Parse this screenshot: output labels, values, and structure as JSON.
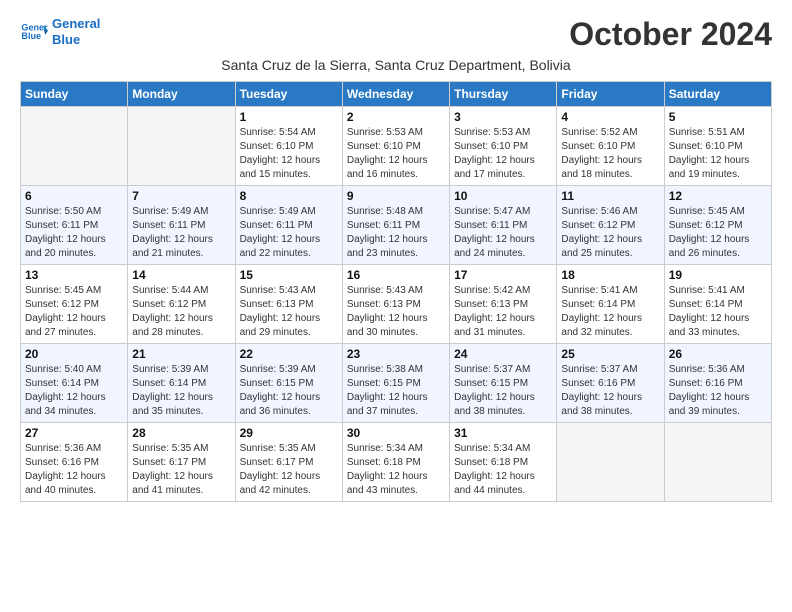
{
  "header": {
    "logo_line1": "General",
    "logo_line2": "Blue",
    "month_title": "October 2024",
    "subtitle": "Santa Cruz de la Sierra, Santa Cruz Department, Bolivia"
  },
  "weekdays": [
    "Sunday",
    "Monday",
    "Tuesday",
    "Wednesday",
    "Thursday",
    "Friday",
    "Saturday"
  ],
  "weeks": [
    [
      {
        "day": "",
        "info": ""
      },
      {
        "day": "",
        "info": ""
      },
      {
        "day": "1",
        "sunrise": "5:54 AM",
        "sunset": "6:10 PM",
        "daylight": "12 hours and 15 minutes."
      },
      {
        "day": "2",
        "sunrise": "5:53 AM",
        "sunset": "6:10 PM",
        "daylight": "12 hours and 16 minutes."
      },
      {
        "day": "3",
        "sunrise": "5:53 AM",
        "sunset": "6:10 PM",
        "daylight": "12 hours and 17 minutes."
      },
      {
        "day": "4",
        "sunrise": "5:52 AM",
        "sunset": "6:10 PM",
        "daylight": "12 hours and 18 minutes."
      },
      {
        "day": "5",
        "sunrise": "5:51 AM",
        "sunset": "6:10 PM",
        "daylight": "12 hours and 19 minutes."
      }
    ],
    [
      {
        "day": "6",
        "sunrise": "5:50 AM",
        "sunset": "6:11 PM",
        "daylight": "12 hours and 20 minutes."
      },
      {
        "day": "7",
        "sunrise": "5:49 AM",
        "sunset": "6:11 PM",
        "daylight": "12 hours and 21 minutes."
      },
      {
        "day": "8",
        "sunrise": "5:49 AM",
        "sunset": "6:11 PM",
        "daylight": "12 hours and 22 minutes."
      },
      {
        "day": "9",
        "sunrise": "5:48 AM",
        "sunset": "6:11 PM",
        "daylight": "12 hours and 23 minutes."
      },
      {
        "day": "10",
        "sunrise": "5:47 AM",
        "sunset": "6:11 PM",
        "daylight": "12 hours and 24 minutes."
      },
      {
        "day": "11",
        "sunrise": "5:46 AM",
        "sunset": "6:12 PM",
        "daylight": "12 hours and 25 minutes."
      },
      {
        "day": "12",
        "sunrise": "5:45 AM",
        "sunset": "6:12 PM",
        "daylight": "12 hours and 26 minutes."
      }
    ],
    [
      {
        "day": "13",
        "sunrise": "5:45 AM",
        "sunset": "6:12 PM",
        "daylight": "12 hours and 27 minutes."
      },
      {
        "day": "14",
        "sunrise": "5:44 AM",
        "sunset": "6:12 PM",
        "daylight": "12 hours and 28 minutes."
      },
      {
        "day": "15",
        "sunrise": "5:43 AM",
        "sunset": "6:13 PM",
        "daylight": "12 hours and 29 minutes."
      },
      {
        "day": "16",
        "sunrise": "5:43 AM",
        "sunset": "6:13 PM",
        "daylight": "12 hours and 30 minutes."
      },
      {
        "day": "17",
        "sunrise": "5:42 AM",
        "sunset": "6:13 PM",
        "daylight": "12 hours and 31 minutes."
      },
      {
        "day": "18",
        "sunrise": "5:41 AM",
        "sunset": "6:14 PM",
        "daylight": "12 hours and 32 minutes."
      },
      {
        "day": "19",
        "sunrise": "5:41 AM",
        "sunset": "6:14 PM",
        "daylight": "12 hours and 33 minutes."
      }
    ],
    [
      {
        "day": "20",
        "sunrise": "5:40 AM",
        "sunset": "6:14 PM",
        "daylight": "12 hours and 34 minutes."
      },
      {
        "day": "21",
        "sunrise": "5:39 AM",
        "sunset": "6:14 PM",
        "daylight": "12 hours and 35 minutes."
      },
      {
        "day": "22",
        "sunrise": "5:39 AM",
        "sunset": "6:15 PM",
        "daylight": "12 hours and 36 minutes."
      },
      {
        "day": "23",
        "sunrise": "5:38 AM",
        "sunset": "6:15 PM",
        "daylight": "12 hours and 37 minutes."
      },
      {
        "day": "24",
        "sunrise": "5:37 AM",
        "sunset": "6:15 PM",
        "daylight": "12 hours and 38 minutes."
      },
      {
        "day": "25",
        "sunrise": "5:37 AM",
        "sunset": "6:16 PM",
        "daylight": "12 hours and 38 minutes."
      },
      {
        "day": "26",
        "sunrise": "5:36 AM",
        "sunset": "6:16 PM",
        "daylight": "12 hours and 39 minutes."
      }
    ],
    [
      {
        "day": "27",
        "sunrise": "5:36 AM",
        "sunset": "6:16 PM",
        "daylight": "12 hours and 40 minutes."
      },
      {
        "day": "28",
        "sunrise": "5:35 AM",
        "sunset": "6:17 PM",
        "daylight": "12 hours and 41 minutes."
      },
      {
        "day": "29",
        "sunrise": "5:35 AM",
        "sunset": "6:17 PM",
        "daylight": "12 hours and 42 minutes."
      },
      {
        "day": "30",
        "sunrise": "5:34 AM",
        "sunset": "6:18 PM",
        "daylight": "12 hours and 43 minutes."
      },
      {
        "day": "31",
        "sunrise": "5:34 AM",
        "sunset": "6:18 PM",
        "daylight": "12 hours and 44 minutes."
      },
      {
        "day": "",
        "info": ""
      },
      {
        "day": "",
        "info": ""
      }
    ]
  ]
}
